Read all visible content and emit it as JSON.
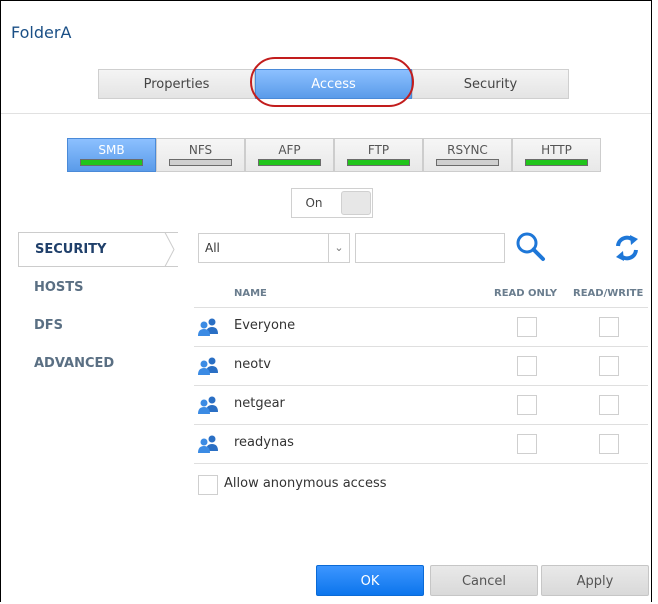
{
  "dialog": {
    "title": "FolderA"
  },
  "main_tabs": [
    {
      "label": "Properties",
      "active": false
    },
    {
      "label": "Access",
      "active": true
    },
    {
      "label": "Security",
      "active": false
    }
  ],
  "protocol_tabs": [
    {
      "label": "SMB",
      "active": true,
      "status": "green"
    },
    {
      "label": "NFS",
      "active": false,
      "status": "gray"
    },
    {
      "label": "AFP",
      "active": false,
      "status": "green"
    },
    {
      "label": "FTP",
      "active": false,
      "status": "green"
    },
    {
      "label": "RSYNC",
      "active": false,
      "status": "gray"
    },
    {
      "label": "HTTP",
      "active": false,
      "status": "green"
    }
  ],
  "toggle": {
    "label": "On"
  },
  "sidenav": [
    {
      "label": "SECURITY",
      "active": true
    },
    {
      "label": "HOSTS",
      "active": false
    },
    {
      "label": "DFS",
      "active": false
    },
    {
      "label": "ADVANCED",
      "active": false
    }
  ],
  "filter": {
    "selected": "All",
    "search_value": ""
  },
  "table": {
    "headers": {
      "name": "NAME",
      "read_only": "READ ONLY",
      "read_write": "READ/WRITE"
    },
    "rows": [
      {
        "name": "Everyone",
        "icon": "group-icon",
        "read_only": false,
        "read_write": false
      },
      {
        "name": "neotv",
        "icon": "group-icon",
        "read_only": false,
        "read_write": false
      },
      {
        "name": "netgear",
        "icon": "group-icon",
        "read_only": false,
        "read_write": false
      },
      {
        "name": "readynas",
        "icon": "group-icon",
        "read_only": false,
        "read_write": false
      }
    ]
  },
  "anonymous": {
    "label": "Allow anonymous access",
    "checked": false
  },
  "buttons": {
    "ok": "OK",
    "cancel": "Cancel",
    "apply": "Apply"
  },
  "colors": {
    "accent": "#0c75ec",
    "title": "#1a4f86",
    "status_green": "#21c51b",
    "highlight": "#c21d1d"
  }
}
